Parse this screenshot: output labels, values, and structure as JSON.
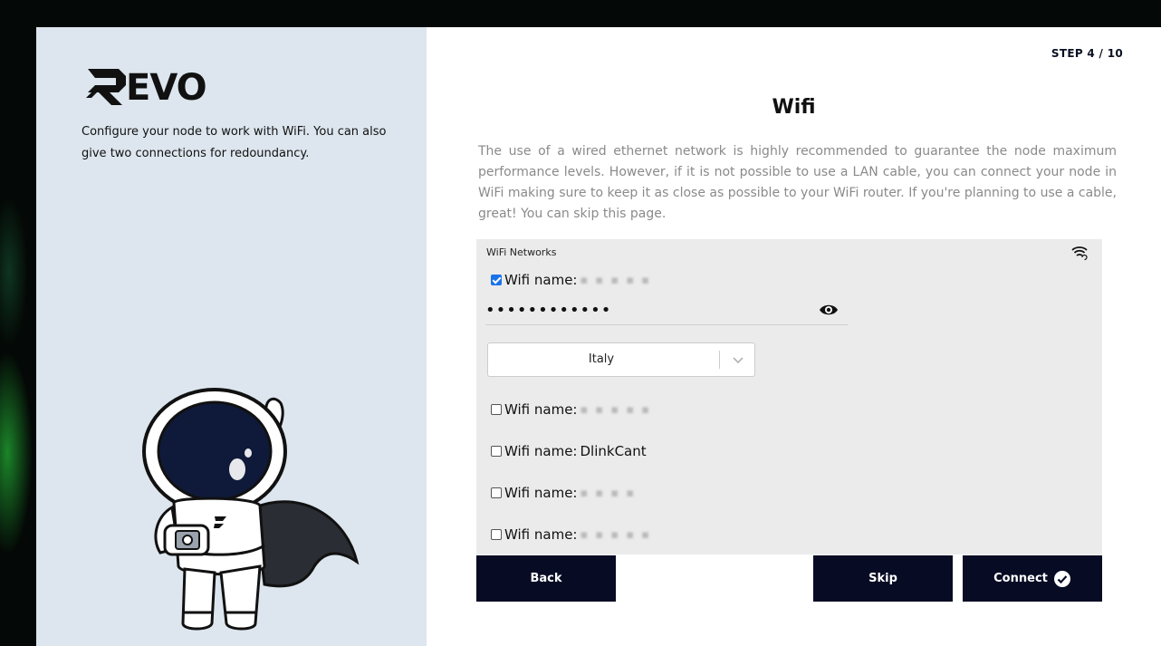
{
  "brand": {
    "name": "REVO",
    "tagline": "Configure your node to work with WiFi. You can also give two connections for redoundancy."
  },
  "header": {
    "step": "STEP 4 / 10",
    "title": "Wifi"
  },
  "description": "The use of a wired ethernet network is highly recommended to guarantee the node maximum performance levels. However, if it is not possible to use a LAN cable, you can connect your node in WiFi making sure to keep it as close as possible to your WiFi router. If you're planning to use a cable, great! You can skip this page.",
  "networks": {
    "header": "WiFi Networks",
    "label_prefix": "Wifi name:",
    "items": [
      {
        "name": "",
        "checked": true
      },
      {
        "name": "",
        "checked": false
      },
      {
        "name": "DlinkCant",
        "checked": false
      },
      {
        "name": "",
        "checked": false
      },
      {
        "name": "",
        "checked": false
      }
    ],
    "password_value": "••••••••••••",
    "country": "Italy"
  },
  "buttons": {
    "back": "Back",
    "skip": "Skip",
    "connect": "Connect"
  },
  "colors": {
    "button_bg": "#070b24",
    "left_panel_bg": "#dde6ee",
    "checkbox_checked": "#1a73e8"
  }
}
